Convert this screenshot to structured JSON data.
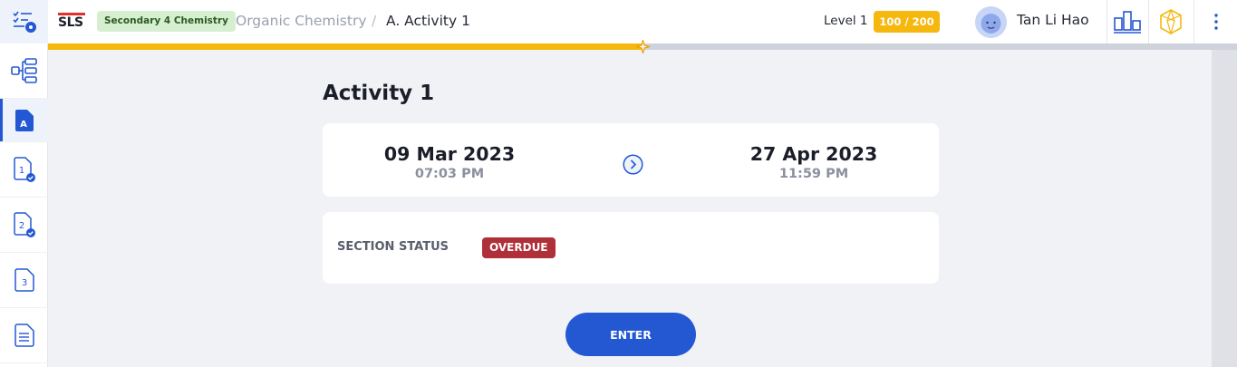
{
  "header": {
    "logo_text": "SLS",
    "subject_badge": "Secondary 4 Chemistry",
    "breadcrumb": [
      "Organic Chemistry",
      "/",
      "A. Activity 1"
    ],
    "level_label": "Level 1",
    "xp_badge": "100 / 200",
    "user_name": "Tan Li Hao",
    "accent_color": "#f6b70f",
    "brand_red": "#e0312b"
  },
  "progress": {
    "fraction": 0.5
  },
  "sidebar": {
    "items": [
      {
        "icon": "checklist-settings-icon",
        "label": ""
      },
      {
        "icon": "lesson-map-icon",
        "label": ""
      },
      {
        "icon": "section-document-icon",
        "label": "A",
        "active": true
      },
      {
        "icon": "activity-document-done-icon",
        "label": "1"
      },
      {
        "icon": "activity-document-done-icon",
        "label": "2"
      },
      {
        "icon": "activity-document-icon",
        "label": "3"
      },
      {
        "icon": "document-lines-icon",
        "label": ""
      }
    ]
  },
  "main": {
    "title": "Activity 1",
    "start": {
      "date": "09 Mar 2023",
      "time": "07:03 PM"
    },
    "end": {
      "date": "27 Apr 2023",
      "time": "11:59 PM"
    },
    "status_label": "SECTION STATUS",
    "status_value": "OVERDUE",
    "status_color": "#b0303a",
    "enter_label": "ENTER",
    "primary_color": "#2458d3"
  }
}
